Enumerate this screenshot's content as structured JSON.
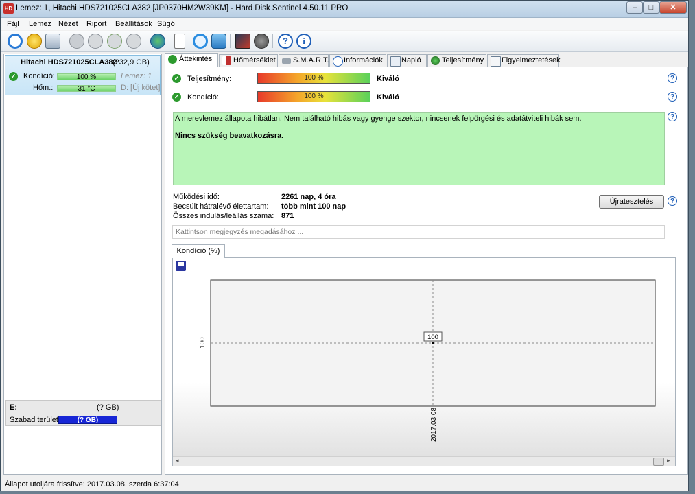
{
  "window": {
    "title": "Lemez: 1, Hitachi HDS721025CLA382 [JP0370HM2W39KM]  -  Hard Disk Sentinel 4.50.11 PRO",
    "minimize_glyph": "–",
    "maximize_glyph": "□",
    "close_glyph": "✕"
  },
  "menu": [
    "Fájl",
    "Lemez",
    "Nézet",
    "Riport",
    "Beállítások",
    "Súgó"
  ],
  "toolbar": {
    "icons": [
      "refresh-icon",
      "alert-icon",
      "disk-icon",
      "satellite-icon",
      "satellite-icon",
      "satellite-icon",
      "satellite-icon",
      "globe-icon",
      "document-icon",
      "sync-icon",
      "network-icon",
      "report-icon",
      "speaker-icon",
      "help-icon",
      "info-icon"
    ],
    "help_glyph": "?",
    "info_glyph": "i"
  },
  "disk": {
    "name": "Hitachi HDS721025CLA382",
    "size": "(232,9 GB)",
    "condition_label": "Kondíció:",
    "condition_value": "100 %",
    "disk_index": "Lemez: 1",
    "temp_label": "Hőm.:",
    "temp_value": "31 °C",
    "volume": "D: [Új kötet]"
  },
  "partition": {
    "drive": "E:",
    "size": "(? GB)",
    "free_label": "Szabad terület",
    "free_value": "(? GB)"
  },
  "tabs": [
    "Áttekintés",
    "Hőmérséklet",
    "S.M.A.R.T.",
    "Információk",
    "Napló",
    "Teljesítmény",
    "Figyelmeztetések"
  ],
  "overview": {
    "check_glyph": "✓",
    "help_glyph": "?",
    "performance_label": "Teljesítmény:",
    "performance_value": "100 %",
    "performance_percent": 100,
    "performance_rating": "Kiváló",
    "condition_label": "Kondíció:",
    "condition_value": "100 %",
    "condition_percent": 100,
    "condition_rating": "Kiváló",
    "status_text": "A merevlemez állapota hibátlan. Nem található hibás vagy gyenge szektor, nincsenek felpörgési és adatátviteli hibák sem.",
    "status_action": "Nincs szükség beavatkozásra.",
    "uptime_label": "Működési idő:",
    "uptime_value": "2261 nap, 4 óra",
    "lifetime_label": "Becsült hátralévő élettartam:",
    "lifetime_value": "több mint 100 nap",
    "startstop_label": "Összes indulás/leállás száma:",
    "startstop_value": "871",
    "retest_button": "Újratesztelés",
    "note_placeholder": "Kattintson megjegyzés megadásához ..."
  },
  "chart_tab": "Kondíció  (%)",
  "chart_data": {
    "type": "line",
    "x": [
      "2017.03.08"
    ],
    "series": [
      {
        "values": [
          100
        ]
      }
    ],
    "data_labels": [
      "100"
    ],
    "y_tick_labels": [
      "100"
    ],
    "x_tick_labels": [
      "2017.03.08"
    ],
    "grid": true
  },
  "scrollbar": {
    "left_glyph": "◂",
    "right_glyph": "▸"
  },
  "statusbar": {
    "text": "Állapot utoljára frissítve: 2017.03.08. szerda 6:37:04"
  }
}
